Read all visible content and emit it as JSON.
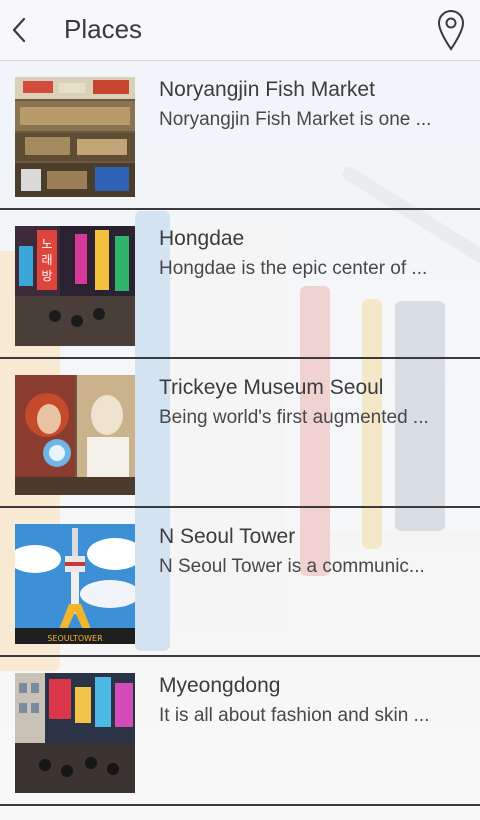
{
  "header": {
    "title": "Places",
    "back_icon": "chevron-left-icon",
    "map_icon": "map-pin-icon"
  },
  "places": [
    {
      "title": "Noryangjin Fish Market",
      "description": "Noryangjin Fish Market is one ..."
    },
    {
      "title": "Hongdae",
      "description": "Hongdae is the epic center of ..."
    },
    {
      "title": "Trickeye Museum Seoul",
      "description": "Being world's first augmented ..."
    },
    {
      "title": "N Seoul Tower",
      "description": "N Seoul Tower is a communic..."
    },
    {
      "title": "Myeongdong",
      "description": "It is all about fashion and skin ..."
    }
  ],
  "thumbnail_texts": {
    "hongdae_sign": "노래방",
    "tower_sign": "SEOULTOWER"
  },
  "colors": {
    "header_bg": "#f8f8fa",
    "title_text": "#3a3a3c",
    "row_divider": "#3b3b3d"
  }
}
